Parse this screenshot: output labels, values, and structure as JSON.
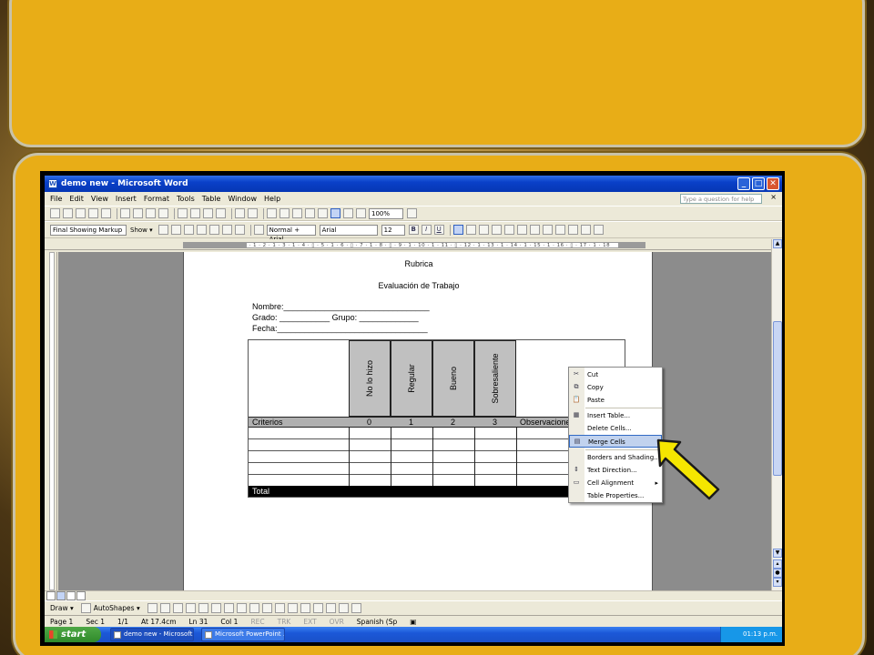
{
  "window": {
    "title": "demo new - Microsoft Word",
    "controls": [
      "_",
      "□",
      "✕"
    ]
  },
  "menu": {
    "items": [
      "File",
      "Edit",
      "View",
      "Insert",
      "Format",
      "Tools",
      "Table",
      "Window",
      "Help"
    ],
    "help_placeholder": "Type a question for help",
    "help_close": "×"
  },
  "toolbar1": {
    "zoom": "100%"
  },
  "toolbar2": {
    "markup_view": "Final Showing Markup",
    "show_label": "Show ▾",
    "style": "Normal + Arial",
    "font": "Arial",
    "size": "12"
  },
  "ruler": {
    "marks": "3 · 1 · 2 · 1 · 1 · ▽ · 1 · 1 · 2 · 1 · 3 · 1 · 4 · ▯ · 5 · 1 · 6 · ▯ · 7 · 1 · 8 · ▯ · 9 · 1 · 10 · 1 · 11 · ▯ · 12 · 1 · 13 · 1 · 14 · 1 · 15 · 1 · 16 · ▯ · 17 · 1 · 18"
  },
  "document": {
    "title": "Rubrica",
    "subtitle": "Evaluación de Trabajo",
    "nombre": "Nombre:________________________________",
    "grado": "Grado: ___________ Grupo: _____________",
    "fecha": "Fecha:_________________________________",
    "table": {
      "headers": [
        "No lo hizo",
        "Regular",
        "Bueno",
        "Sobresaliente"
      ],
      "criteria_label": "Criterios",
      "scores": [
        "0",
        "1",
        "2",
        "3"
      ],
      "observ_label": "Observaciones",
      "total_label": "Total"
    }
  },
  "context_menu": {
    "items": [
      {
        "label": "Cut",
        "icon": "scissors-icon"
      },
      {
        "label": "Copy",
        "icon": "copy-icon"
      },
      {
        "label": "Paste",
        "icon": "paste-icon"
      },
      {
        "label": "Insert Table...",
        "icon": "insert-table-icon"
      },
      {
        "label": "Delete Cells...",
        "icon": ""
      },
      {
        "label": "Merge Cells",
        "icon": "merge-cells-icon",
        "highlighted": true
      },
      {
        "label": "Borders and Shading...",
        "icon": ""
      },
      {
        "label": "Text Direction...",
        "icon": "text-direction-icon"
      },
      {
        "label": "Cell Alignment",
        "icon": "cell-alignment-icon",
        "submenu": "▸"
      },
      {
        "label": "Table Properties...",
        "icon": ""
      }
    ]
  },
  "drawbar": {
    "draw": "Draw ▾",
    "autoshapes": "AutoShapes ▾"
  },
  "status": {
    "page": "Page 1",
    "sec": "Sec 1",
    "pages": "1/1",
    "at": "At 17.4cm",
    "ln": "Ln 31",
    "col": "Col 1",
    "rec": "REC",
    "trk": "TRK",
    "ext": "EXT",
    "ovr": "OVR",
    "lang": "Spanish (Sp"
  },
  "taskbar": {
    "start": "start",
    "tasks": [
      "demo new - Microsoft...",
      "Microsoft PowerPoint ..."
    ],
    "clock": "01:13 p.m."
  },
  "colors": {
    "background_panel": "#e8ad17",
    "titlebar": "#0a40c8",
    "highlight": "#c1d2ee",
    "arrow": "#f5e600"
  }
}
